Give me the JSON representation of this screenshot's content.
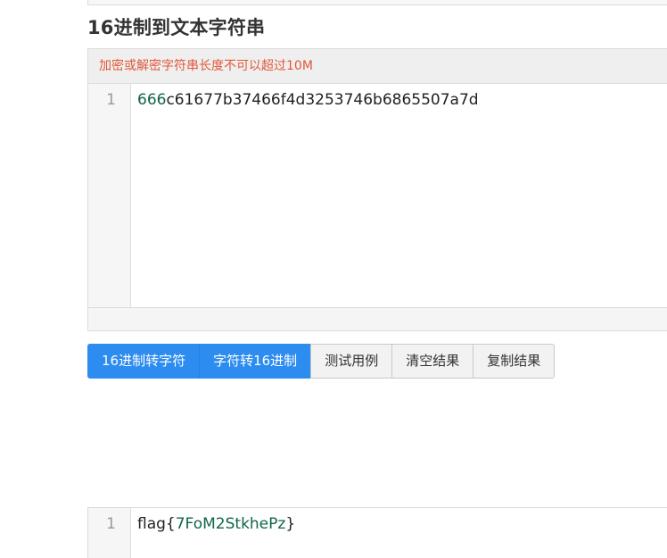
{
  "page": {
    "title": "16进制到文本字符串"
  },
  "input_panel": {
    "notice": "加密或解密字符串长度不可以超过10M",
    "line_number": "1",
    "code_prefix": "666",
    "code_rest": "c61677b37466f4d3253746b6865507a7d"
  },
  "buttons": {
    "hex_to_text": "16进制转字符",
    "text_to_hex": "字符转16进制",
    "test_example": "测试用例",
    "clear_result": "清空结果",
    "copy_result": "复制结果"
  },
  "output_panel": {
    "line_number": "1",
    "code_prefix": "flag{",
    "code_inner": "7FoM2StkhePz",
    "code_suffix": "}"
  },
  "colors": {
    "primary_button": "#2d8cf0",
    "notice_text": "#e0583a",
    "number_token": "#116644"
  }
}
